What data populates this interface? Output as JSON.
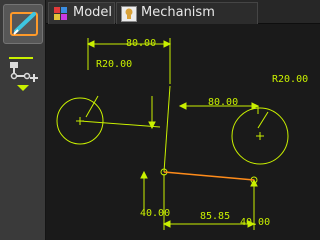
{
  "tabs": [
    {
      "label": "Model",
      "icon": "model-colorblocks-icon",
      "active": true
    },
    {
      "label": "Mechanism",
      "icon": "lightbulb-icon",
      "active": false
    }
  ],
  "toolbar": {
    "sketch_tool_icon": "pencil-sketch-icon",
    "mechanism_tool_icon": "linkage-dropdown-icon"
  },
  "canvas": {
    "dimensions": {
      "top_width": "80.00",
      "left_radius": "R20.00",
      "right_width": "80.00",
      "right_radius": "R20.00",
      "left_offset": "40.00",
      "link_length": "85.85",
      "right_offset": "40.00"
    },
    "colors": {
      "geometry": "#c9f000",
      "link": "#ff8c1a",
      "background": "#1a1a1a"
    }
  }
}
